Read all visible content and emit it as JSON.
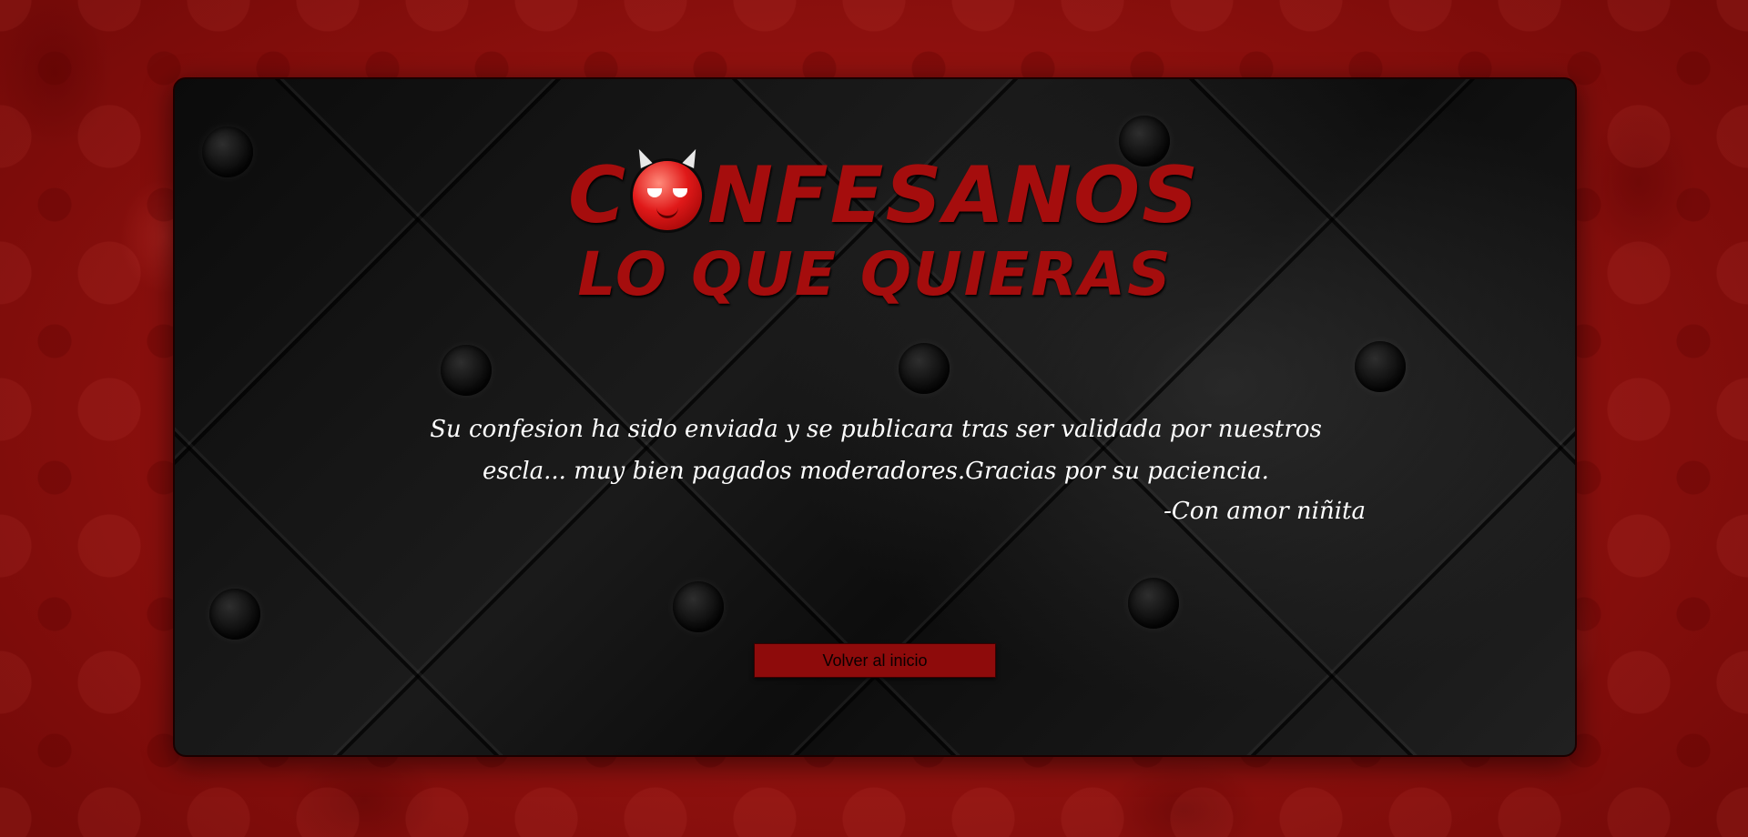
{
  "logo": {
    "line1_before": "C",
    "line1_after": "NFESANOS",
    "line2": "LO QUE QUIERAS",
    "icon": "devil-face-icon"
  },
  "message": {
    "text": "Su confesion ha sido enviada y se publicara tras ser validada por nuestros escla... muy bien pagados moderadores.Gracias por su paciencia.",
    "signature": "-Con amor niñita"
  },
  "actions": {
    "back_label": "Volver al inicio"
  },
  "colors": {
    "accent": "#a50d0d",
    "button": "#8e0b0b",
    "panel": "#111111",
    "background": "#a3120f"
  }
}
